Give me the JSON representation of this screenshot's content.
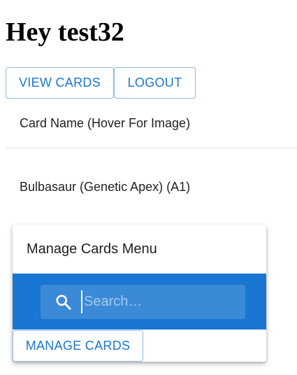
{
  "header": {
    "greeting": "Hey test32"
  },
  "nav": {
    "view_cards_label": "VIEW CARDS",
    "logout_label": "LOGOUT"
  },
  "table": {
    "column_header": "Card Name (Hover For Image)",
    "rows": [
      {
        "card_name": "Bulbasaur (Genetic Apex) (A1)"
      }
    ]
  },
  "menu": {
    "title": "Manage Cards Menu",
    "search": {
      "placeholder": "Search…",
      "value": ""
    },
    "manage_label": "MANAGE CARDS"
  },
  "colors": {
    "primary": "#1976d2",
    "text": "#212121",
    "divider": "#e0e0e0"
  },
  "icons": {
    "search": "search-icon"
  }
}
